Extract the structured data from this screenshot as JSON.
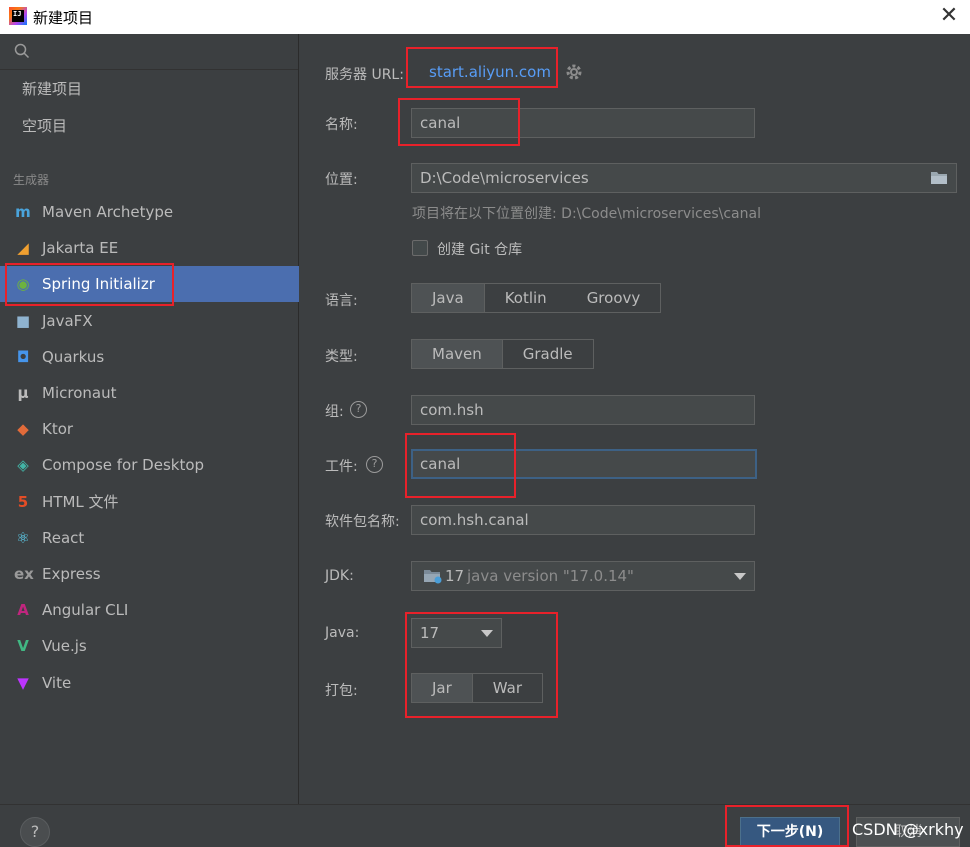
{
  "window": {
    "title": "新建项目",
    "app_icon": "intellij-icon",
    "close_glyph": "✕"
  },
  "sidebar": {
    "top_items": [
      {
        "label": "新建项目"
      },
      {
        "label": "空项目"
      }
    ],
    "generators_header": "生成器",
    "generators": [
      {
        "label": "Maven Archetype",
        "icon": "maven-icon",
        "glyph": "m",
        "color": "#4aa4dc"
      },
      {
        "label": "Jakarta EE",
        "icon": "jakarta-icon",
        "glyph": "◢",
        "color": "#f0a030"
      },
      {
        "label": "Spring Initializr",
        "icon": "spring-icon",
        "glyph": "◉",
        "color": "#6db33f",
        "selected": true
      },
      {
        "label": "JavaFX",
        "icon": "javafx-icon",
        "glyph": "■",
        "color": "#8fb3d0"
      },
      {
        "label": "Quarkus",
        "icon": "quarkus-icon",
        "glyph": "◘",
        "color": "#4695eb"
      },
      {
        "label": "Micronaut",
        "icon": "micronaut-icon",
        "glyph": "μ",
        "color": "#bbbbbb"
      },
      {
        "label": "Ktor",
        "icon": "ktor-icon",
        "glyph": "◆",
        "color": "#e26b3a"
      },
      {
        "label": "Compose for Desktop",
        "icon": "compose-icon",
        "glyph": "◈",
        "color": "#42b4a6"
      },
      {
        "label": "HTML 文件",
        "icon": "html-icon",
        "glyph": "5",
        "color": "#e44d26"
      },
      {
        "label": "React",
        "icon": "react-icon",
        "glyph": "⚛",
        "color": "#61dafb"
      },
      {
        "label": "Express",
        "icon": "express-icon",
        "glyph": "ex",
        "color": "#9a9a9a"
      },
      {
        "label": "Angular CLI",
        "icon": "angular-icon",
        "glyph": "A",
        "color": "#c0267e"
      },
      {
        "label": "Vue.js",
        "icon": "vue-icon",
        "glyph": "V",
        "color": "#41b883"
      },
      {
        "label": "Vite",
        "icon": "vite-icon",
        "glyph": "▼",
        "color": "#bd34fe"
      }
    ]
  },
  "form": {
    "server_url_label": "服务器 URL:",
    "server_url_value": "start.aliyun.com",
    "name_label": "名称:",
    "name_value": "canal",
    "location_label": "位置:",
    "location_value": "D:\\Code\\microservices",
    "location_hint": "项目将在以下位置创建: D:\\Code\\microservices\\canal",
    "git_label": "创建 Git 仓库",
    "git_checked": false,
    "language_label": "语言:",
    "languages": [
      "Java",
      "Kotlin",
      "Groovy"
    ],
    "language_selected": "Java",
    "type_label": "类型:",
    "types": [
      "Maven",
      "Gradle"
    ],
    "type_selected": "Maven",
    "group_label": "组:",
    "group_value": "com.hsh",
    "artifact_label": "工件:",
    "artifact_value": "canal",
    "package_label": "软件包名称:",
    "package_value": "com.hsh.canal",
    "jdk_label": "JDK:",
    "jdk_version": "17",
    "jdk_desc": "java version \"17.0.14\"",
    "java_label": "Java:",
    "java_value": "17",
    "packaging_label": "打包:",
    "packagings": [
      "Jar",
      "War"
    ],
    "packaging_selected": "Jar"
  },
  "footer": {
    "help_glyph": "?",
    "next_label": "下一步(N)",
    "cancel_label": "取消",
    "watermark": "CSDN @xrkhy"
  },
  "colors": {
    "accent": "#4b6eaf",
    "highlight": "#e8212a",
    "link": "#589df6"
  }
}
